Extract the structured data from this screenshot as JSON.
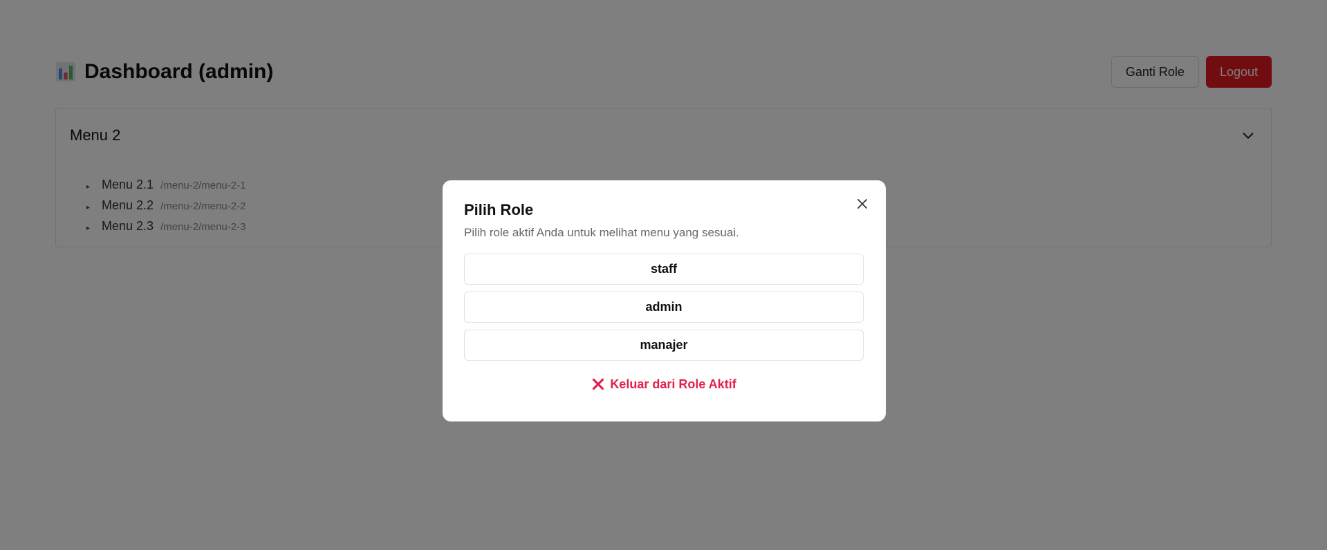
{
  "header": {
    "icon": "bar-chart-icon",
    "title": "Dashboard (admin)",
    "switch_role_label": "Ganti Role",
    "logout_label": "Logout"
  },
  "card": {
    "title": "Menu 2",
    "toggle_icon": "chevron-down-icon",
    "items": [
      {
        "label": "Menu 2.1",
        "path": "/menu-2/menu-2-1"
      },
      {
        "label": "Menu 2.2",
        "path": "/menu-2/menu-2-2"
      },
      {
        "label": "Menu 2.3",
        "path": "/menu-2/menu-2-3"
      }
    ]
  },
  "modal": {
    "title": "Pilih Role",
    "subtitle": "Pilih role aktif Anda untuk melihat menu yang sesuai.",
    "close_icon": "close-icon",
    "roles": [
      "staff",
      "admin",
      "manajer"
    ],
    "exit_label": "Keluar dari Role Aktif",
    "exit_icon": "x-mark-icon"
  },
  "colors": {
    "danger": "#e31b23",
    "exit_text": "#e3204a",
    "overlay": "rgba(0,0,0,0.5)"
  }
}
